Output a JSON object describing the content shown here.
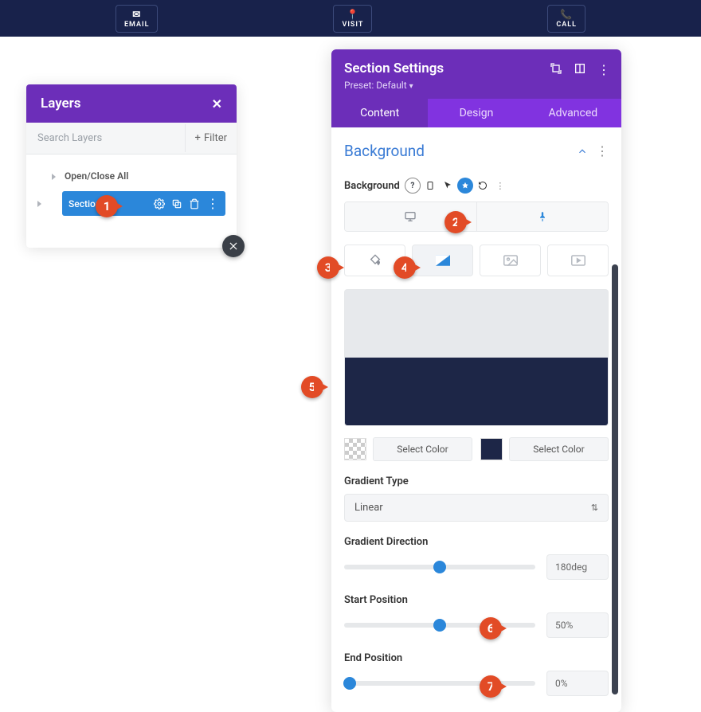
{
  "topbar": {
    "email_label": "EMAIL",
    "visit_label": "VISIT",
    "call_label": "CALL"
  },
  "layers": {
    "title": "Layers",
    "search_placeholder": "Search Layers",
    "filter_label": "Filter",
    "open_close_label": "Open/Close All",
    "section_label": "Section"
  },
  "settings": {
    "title": "Section Settings",
    "preset_label": "Preset: Default",
    "tabs": {
      "content": "Content",
      "design": "Design",
      "advanced": "Advanced"
    },
    "background": {
      "accordion_title": "Background",
      "field_label": "Background",
      "select_color_label": "Select Color",
      "gradient_type_label": "Gradient Type",
      "gradient_type_value": "Linear",
      "gradient_direction_label": "Gradient Direction",
      "gradient_direction_value": "180deg",
      "start_position_label": "Start Position",
      "start_position_value": "50%",
      "end_position_label": "End Position",
      "end_position_value": "0%",
      "colors": {
        "stop1": "transparent",
        "stop2": "#1d2647"
      }
    }
  },
  "annotations": {
    "a1": "1",
    "a2": "2",
    "a3": "3",
    "a4": "4",
    "a5": "5",
    "a6": "6",
    "a7": "7"
  }
}
